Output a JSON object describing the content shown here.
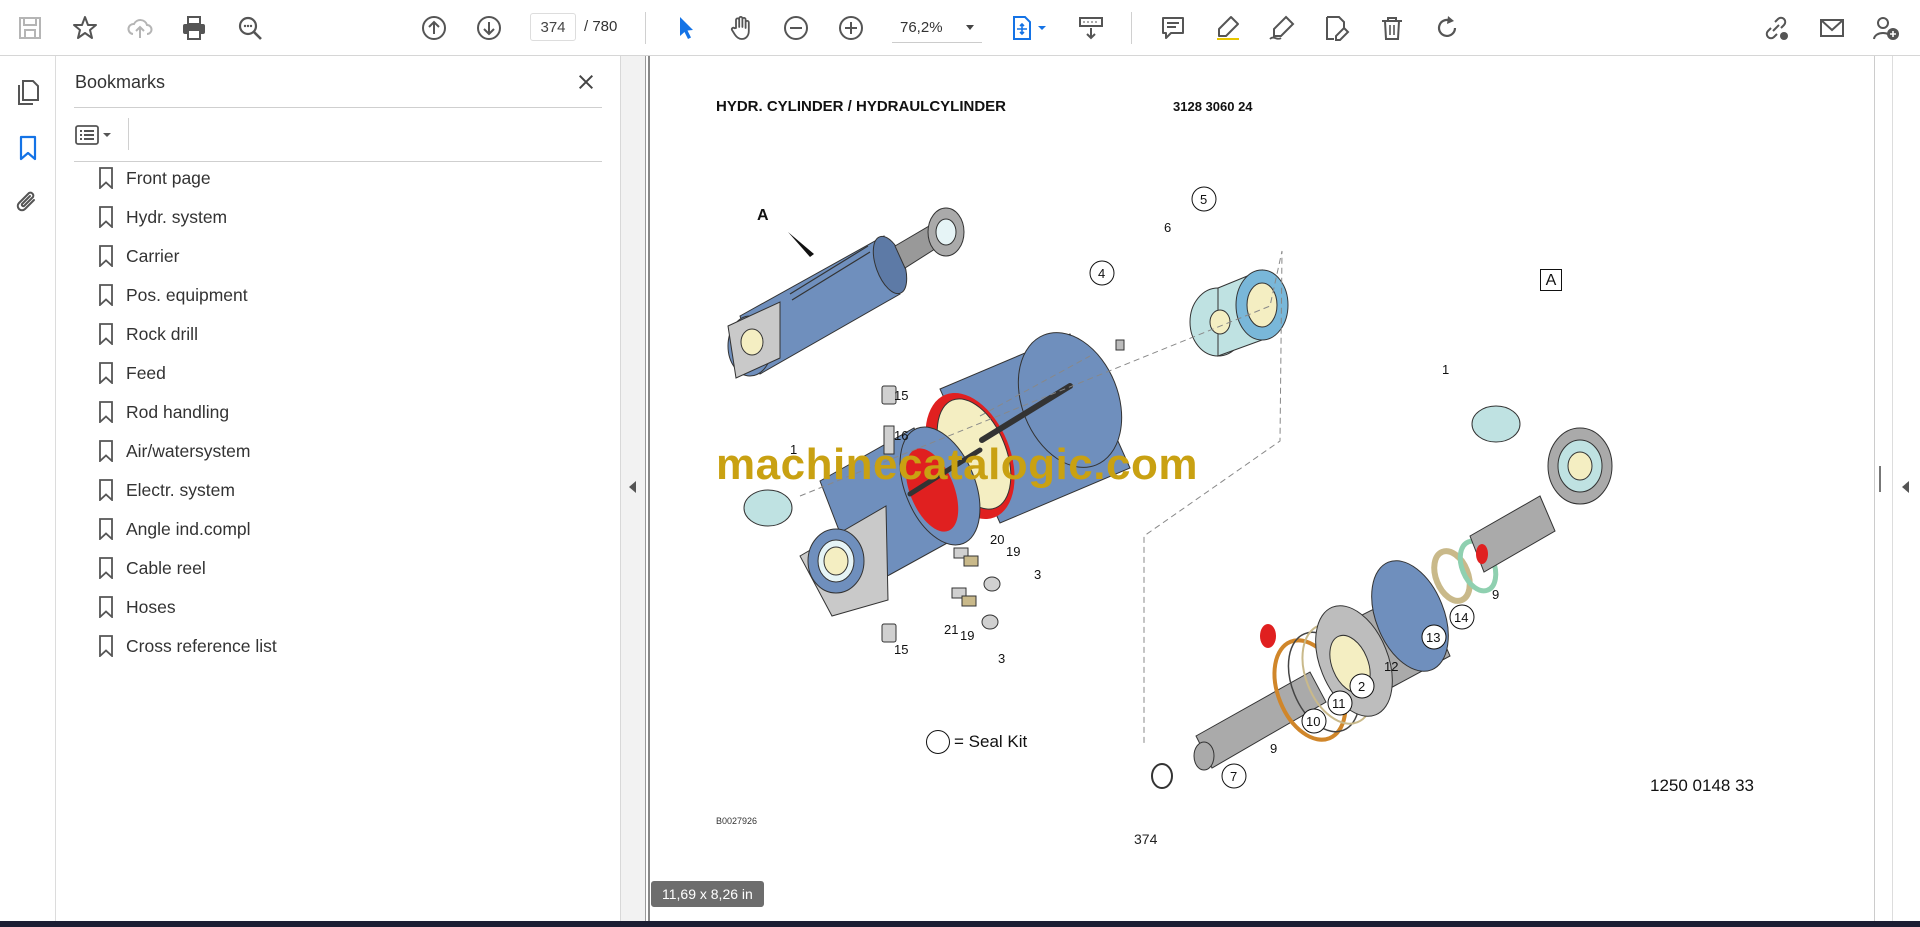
{
  "toolbar": {
    "page_current": "374",
    "page_total": "/ 780",
    "zoom": "76,2%"
  },
  "colors": {
    "accent": "#1473e6",
    "watermark": "#c9a112",
    "cylinder": "#6f8fbd",
    "seal_red": "#e02020"
  },
  "bookmarks": {
    "title": "Bookmarks",
    "items": [
      "Front page",
      "Hydr. system",
      "Carrier",
      "Pos. equipment",
      "Rock drill",
      "Feed",
      "Rod handling",
      "Air/watersystem",
      "Electr. system",
      "Angle ind.compl",
      "Cable reel",
      "Hoses",
      "Cross reference list"
    ]
  },
  "document": {
    "title": "HYDR. CYLINDER / HYDRAULCYLINDER",
    "code": "3128 3060 24",
    "ref": "B0027926",
    "page_number": "374",
    "part_number": "1250 0148 33",
    "seal_kit_label": "= Seal Kit",
    "watermark": "machinecatalogic.com",
    "detail_badge": "A",
    "detail_pointer": "A",
    "callouts": [
      "1",
      "1",
      "2",
      "3",
      "3",
      "4",
      "5",
      "6",
      "7",
      "9",
      "9",
      "10",
      "11",
      "12",
      "13",
      "14",
      "15",
      "15",
      "16",
      "19",
      "19",
      "20",
      "21"
    ]
  },
  "page_size_chip": "11,69 x 8,26 in"
}
